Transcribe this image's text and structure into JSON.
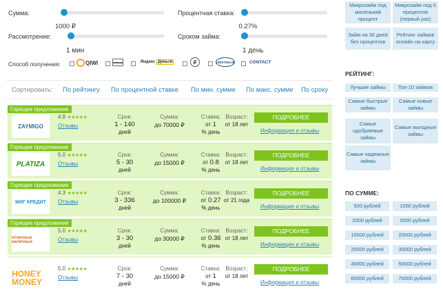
{
  "filters": {
    "sum_label": "Сумма:",
    "sum_value": "1000 ₽",
    "term_review_label": "Рассмотрение:",
    "term_review_value": "1 мин",
    "rate_label": "Процентная ставка:",
    "rate_value": "0.27%",
    "loan_term_label": "Сроком займа:",
    "loan_term_value": "1 день",
    "payment_label": "Способ получения:",
    "payment_methods": [
      "QIWI",
      "Card",
      "Яндекс Деньги",
      "Золотая корона",
      "Unistream",
      "Contact"
    ]
  },
  "sort": {
    "label": "Сортировать:",
    "options": [
      "По рейтингу",
      "По процентной ставке",
      "По мин. сумме",
      "По макс. сумме",
      "По сроку"
    ]
  },
  "columns": {
    "term": "Срок:",
    "sum": "Сумма:",
    "rate": "Ставка:",
    "age": "Возраст:"
  },
  "offers": [
    {
      "hot": "Горящее предложение",
      "logo": "ZAYMIGO",
      "rating": "4.8",
      "stars": "★★★★★",
      "reviews": "Отзывы",
      "term": "1 - 140",
      "term_unit": "дней",
      "sum": "до 70000",
      "sum_unit": "₽",
      "rate_prefix": "от",
      "rate": "1",
      "rate_unit": "% день",
      "age": "от 18 лет",
      "more": "ПОДРОБНЕЕ",
      "info": "Информация и отзывы"
    },
    {
      "hot": "Горящее предложение",
      "logo": "PLATIZA",
      "rating": "5.0",
      "stars": "★★★★★",
      "reviews": "Отзывы",
      "term": "5 - 30",
      "term_unit": "дней",
      "sum": "до 15000",
      "sum_unit": "₽",
      "rate_prefix": "от",
      "rate": "0.8",
      "rate_unit": "% день",
      "age": "от 18 лет",
      "more": "ПОДРОБНЕЕ",
      "info": "Информация и отзывы"
    },
    {
      "hot": "Горящее предложение",
      "logo": "МИГ КРЕДИТ",
      "rating": "4.3",
      "stars": "★★★★★",
      "reviews": "Отзывы",
      "term": "3 - 336",
      "term_unit": "дней",
      "sum": "до 100000",
      "sum_unit": "₽",
      "rate_prefix": "от",
      "rate": "0.27",
      "rate_unit": "% день",
      "age": "от 21 года",
      "more": "ПОДРОБНЕЕ",
      "info": "Информация и отзывы"
    },
    {
      "hot": "Горящее предложение",
      "logo": "отличные наличные",
      "rating": "5.0",
      "stars": "★★★★★",
      "reviews": "Отзывы",
      "term": "3 - 30",
      "term_unit": "дней",
      "sum": "до 30000",
      "sum_unit": "₽",
      "rate_prefix": "от",
      "rate": "0.36",
      "rate_unit": "% день",
      "age": "от 18 лет",
      "more": "ПОДРОБНЕЕ",
      "info": "Информация и отзывы"
    },
    {
      "hot": "",
      "logo": "HONEY MONEY",
      "rating": "5.0",
      "stars": "★★★★★",
      "reviews": "Отзывы",
      "term": "7 - 30",
      "term_unit": "дней",
      "sum": "до 15000",
      "sum_unit": "₽",
      "rate_prefix": "от",
      "rate": "1",
      "rate_unit": "% день",
      "age": "от 18 лет",
      "more": "ПОДРОБНЕЕ",
      "info": "Информация и отзывы"
    }
  ],
  "sidebar": {
    "top_links": [
      "Микрозайм под маленький процент",
      "Микрозайм под 0 процентов (первый раз)",
      "Займ на 30 дней без процентов",
      "Рейтинг займов онлайн на карту"
    ],
    "rating_title": "РЕЙТИНГ:",
    "rating_links": [
      "Лучшие займы",
      "Топ-10 займов",
      "Самые быстрые займы",
      "Самые новые займы",
      "Самые одобряемые займы",
      "Самые выгодные займы",
      "Самые надежные займы"
    ],
    "sum_title": "ПО СУММЕ:",
    "sum_links": [
      "500 рублей",
      "1000 рублей",
      "2000 рублей",
      "5000 рублей",
      "10000 рублей",
      "20000 рублей",
      "25000 рублей",
      "30000 рублей",
      "40000 рублей",
      "50000 рублей",
      "60000 рублей",
      "70000 рублей"
    ]
  },
  "colors": {
    "accent_green": "#7fc41e",
    "row_green": "#e1f6c4",
    "link_blue": "#2980b9",
    "slider_blue": "#1a94d4",
    "sidebar_bg": "#dcebf4"
  }
}
